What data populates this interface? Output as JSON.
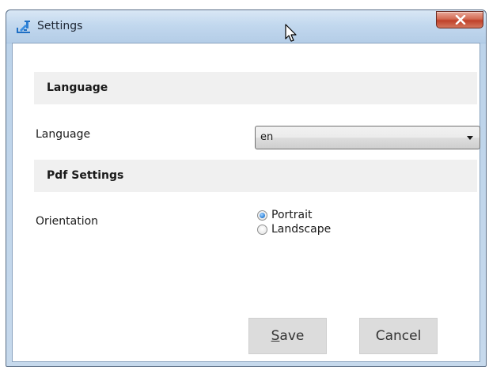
{
  "window": {
    "title": "Settings",
    "close_label": "X"
  },
  "sections": {
    "language_header": "Language",
    "pdf_header": "Pdf Settings"
  },
  "language": {
    "label": "Language",
    "selected_value": "en"
  },
  "orientation": {
    "label": "Orientation",
    "options": [
      {
        "label": "Portrait",
        "selected": true
      },
      {
        "label": "Landscape",
        "selected": false
      }
    ]
  },
  "buttons": {
    "save_accel": "S",
    "save_rest": "ave",
    "cancel": "Cancel"
  },
  "icons": {
    "app": "settings-app-icon",
    "close": "close-icon",
    "dropdown": "chevron-down-icon",
    "cursor": "mouse-cursor-icon"
  },
  "colors": {
    "titlebar": "#c2d8ee",
    "close_button": "#c0412a",
    "section_header_bg": "#f0f0f0",
    "button_bg": "#dcdcdc",
    "radio_selected": "#3d8fe0"
  }
}
